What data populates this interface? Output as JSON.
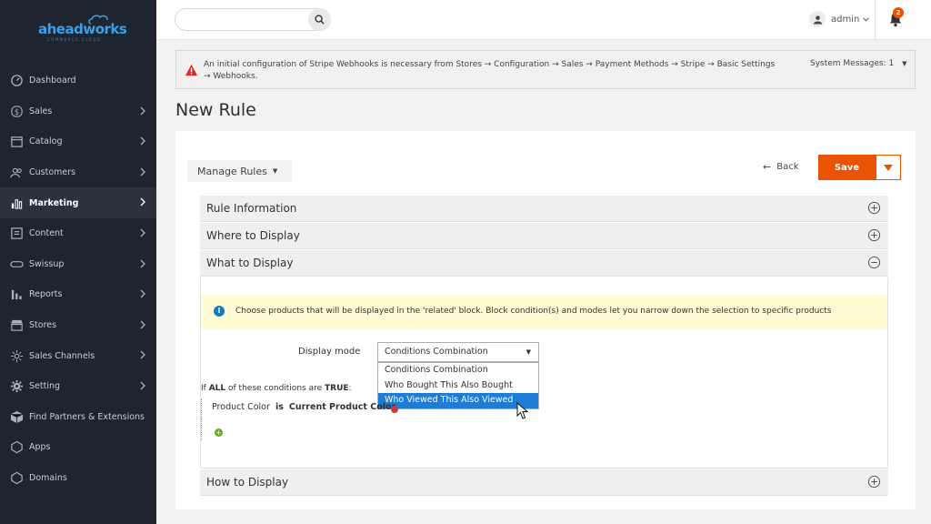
{
  "brand": {
    "name": "aheadworks",
    "tagline": "COMMERCE CLOUD"
  },
  "sidebar": {
    "items": [
      {
        "label": "Dashboard",
        "icon": "dashboard-icon",
        "has_children": false
      },
      {
        "label": "Sales",
        "icon": "dollar-icon",
        "has_children": true
      },
      {
        "label": "Catalog",
        "icon": "catalog-icon",
        "has_children": true
      },
      {
        "label": "Customers",
        "icon": "customers-icon",
        "has_children": true
      },
      {
        "label": "Marketing",
        "icon": "marketing-icon",
        "has_children": true,
        "active": true
      },
      {
        "label": "Content",
        "icon": "content-icon",
        "has_children": true
      },
      {
        "label": "Swissup",
        "icon": "swissup-icon",
        "has_children": true
      },
      {
        "label": "Reports",
        "icon": "reports-icon",
        "has_children": true
      },
      {
        "label": "Stores",
        "icon": "stores-icon",
        "has_children": true
      },
      {
        "label": "Sales Channels",
        "icon": "sales-channels-icon",
        "has_children": true
      },
      {
        "label": "Setting",
        "icon": "gear-icon",
        "has_children": true
      },
      {
        "label": "Find Partners & Extensions",
        "icon": "extensions-icon",
        "has_children": false
      },
      {
        "label": "Apps",
        "icon": "apps-icon",
        "has_children": false
      },
      {
        "label": "Domains",
        "icon": "domains-icon",
        "has_children": false
      }
    ]
  },
  "header": {
    "search": {
      "value": "",
      "placeholder": ""
    },
    "user": "admin",
    "notifications_count": "2"
  },
  "system_message": {
    "text": "An initial configuration of Stripe Webhooks is necessary from Stores → Configuration → Sales → Payment Methods → Stripe → Basic Settings → Webhooks.",
    "counter": "System Messages: 1"
  },
  "page": {
    "title": "New Rule",
    "manage_rules_label": "Manage Rules",
    "back_label": "Back",
    "save_label": "Save"
  },
  "sections": {
    "rule_information": "Rule Information",
    "where_to_display": "Where to Display",
    "what_to_display": "What to Display",
    "how_to_display": "How to Display"
  },
  "what_to_display": {
    "info_text": "Choose products that will be displayed in the 'related' block. Block condition(s) and modes let you narrow down the selection to specific products",
    "display_mode_label": "Display mode",
    "display_mode_value": "Conditions Combination",
    "display_mode_options": [
      "Conditions Combination",
      "Who Bought This Also Bought",
      "Who Viewed This Also Viewed"
    ],
    "highlighted_option_index": 2,
    "conditions": {
      "prefix": "If",
      "aggregator": "ALL",
      "middle": "of these conditions are",
      "value": "TRUE",
      "suffix": ":",
      "rule_attribute": "Product Color",
      "rule_operator": "is",
      "rule_value": "Current Product Color"
    }
  },
  "colors": {
    "accent": "#eb5202",
    "sidebar_bg": "#1f2530",
    "selection": "#1e7bd6",
    "info_bg": "#fffbd4"
  }
}
